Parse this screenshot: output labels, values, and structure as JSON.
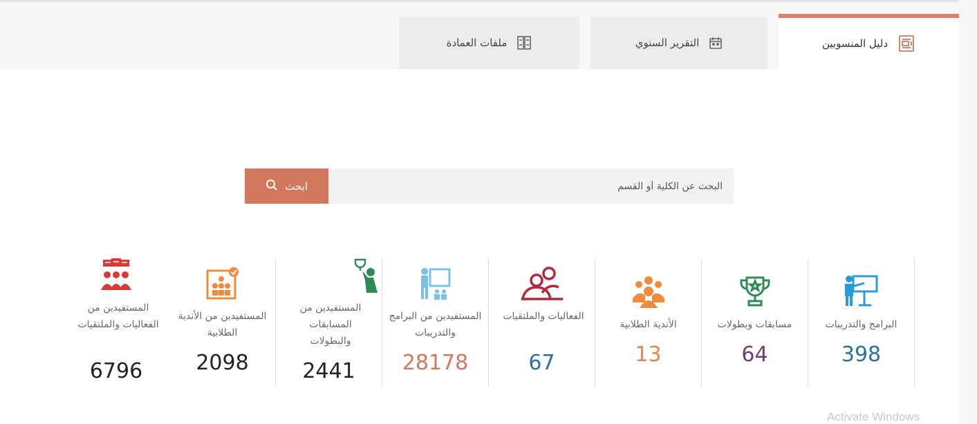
{
  "tabs": [
    {
      "label": "دليل المنسوبين",
      "icon": "document-icon",
      "active": true
    },
    {
      "label": "التقرير السنوي",
      "icon": "calendar-icon",
      "active": false
    },
    {
      "label": "ملفات العمادة",
      "icon": "binders-icon",
      "active": false
    }
  ],
  "search": {
    "placeholder": "البحث عن الكلية أو القسم",
    "button_label": "ابحث"
  },
  "stats": [
    {
      "label": "البرامج والتدريبات",
      "value": "398",
      "color": "#2d6f9e",
      "icon": "presenter-board-icon"
    },
    {
      "label": "مسابقات وبطولات",
      "value": "64",
      "color": "#6a3d7a",
      "icon": "trophy-icon"
    },
    {
      "label": "الأندية الطلابية",
      "value": "13",
      "color": "#e9834a",
      "icon": "group-icon"
    },
    {
      "label": "الفعاليات والملتقيات",
      "value": "67",
      "color": "#2d6f9e",
      "icon": "people-outline-icon"
    },
    {
      "label": "المستفيدين من البرامج والتدريبات",
      "value": "28178",
      "color": "#d2785f",
      "icon": "trainer-board-icon"
    },
    {
      "label": "المستفيدين من المسابقات والبطولات",
      "value": "2441",
      "color": "#222222",
      "icon": "winner-cup-icon"
    },
    {
      "label": "المستفيدين من الأندية الطلابية",
      "value": "2098",
      "color": "#222222",
      "icon": "club-members-icon"
    },
    {
      "label": "المستفيدين من الفعاليات والملتقيات",
      "value": "6796",
      "color": "#222222",
      "icon": "audience-icon"
    }
  ],
  "watermark": "Activate Windows"
}
